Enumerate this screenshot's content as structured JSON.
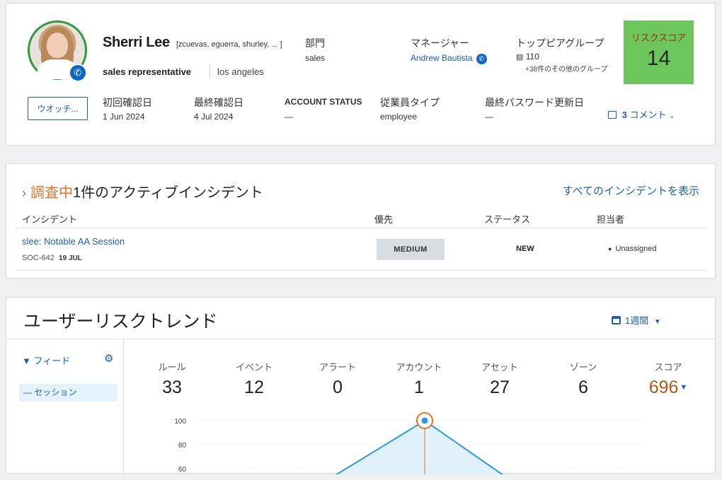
{
  "profile": {
    "name": "Sherri Lee",
    "aliases": "[zcuevas, eguerra, shurley, ... ]",
    "role": "sales representative",
    "location": "los angeles",
    "department_label": "部門",
    "department_value": "sales",
    "manager_label": "マネージャー",
    "manager_value": "Andrew Bautista",
    "peer_group_label": "トップピアグループ",
    "peer_group_value": "110",
    "peer_group_more": "+38件のその他のグループ",
    "risk_label": "リスクスコア",
    "risk_value": "14",
    "watch_button": "ウオッチ...",
    "first_seen_label": "初回確認日",
    "first_seen_value": "1 Jun 2024",
    "last_seen_label": "最終確認日",
    "last_seen_value": "4 Jul 2024",
    "account_status_label": "ACCOUNT STATUS",
    "account_status_value": "—",
    "employee_type_label": "従業員タイプ",
    "employee_type_value": "employee",
    "last_pw_label": "最終パスワード更新日",
    "last_pw_value": "—",
    "comments_count": "3",
    "comments_label": "コメント",
    "colors": {
      "risk_bg": "#6cc65b",
      "avatar_ring": "#2e9b3e"
    }
  },
  "incidents": {
    "status_word": "調査中",
    "title": "1件のアクティブインシデント",
    "view_all": "すべてのインシデントを表示",
    "columns": [
      "インシデント",
      "優先",
      "ステータス",
      "担当者"
    ],
    "rows": [
      {
        "name": "slee: Notable AA Session",
        "id": "SOC-642",
        "date": "19 JUL",
        "priority": "MEDIUM",
        "status": "NEW",
        "assignee": "Unassigned"
      }
    ]
  },
  "trend": {
    "title": "ユーザーリスクトレンド",
    "period": "1週間",
    "feed_label": "フィード",
    "session_item": "セッション",
    "stats": [
      {
        "label": "ルール",
        "value": "33"
      },
      {
        "label": "イベント",
        "value": "12"
      },
      {
        "label": "アラート",
        "value": "0"
      },
      {
        "label": "アカウント",
        "value": "1"
      },
      {
        "label": "アセット",
        "value": "27"
      },
      {
        "label": "ゾーン",
        "value": "6"
      },
      {
        "label": "スコア",
        "value": "696"
      }
    ]
  },
  "chart_data": {
    "type": "area",
    "yticks": [
      "100",
      "80",
      "60"
    ],
    "ylim": [
      0,
      100
    ],
    "x": [
      0,
      1,
      2
    ],
    "values": [
      55,
      100,
      55
    ],
    "highlight_index": 1,
    "colors": {
      "line": "#2b9be4",
      "fill": "#e1f1fb",
      "highlight": "#e8702a"
    }
  }
}
